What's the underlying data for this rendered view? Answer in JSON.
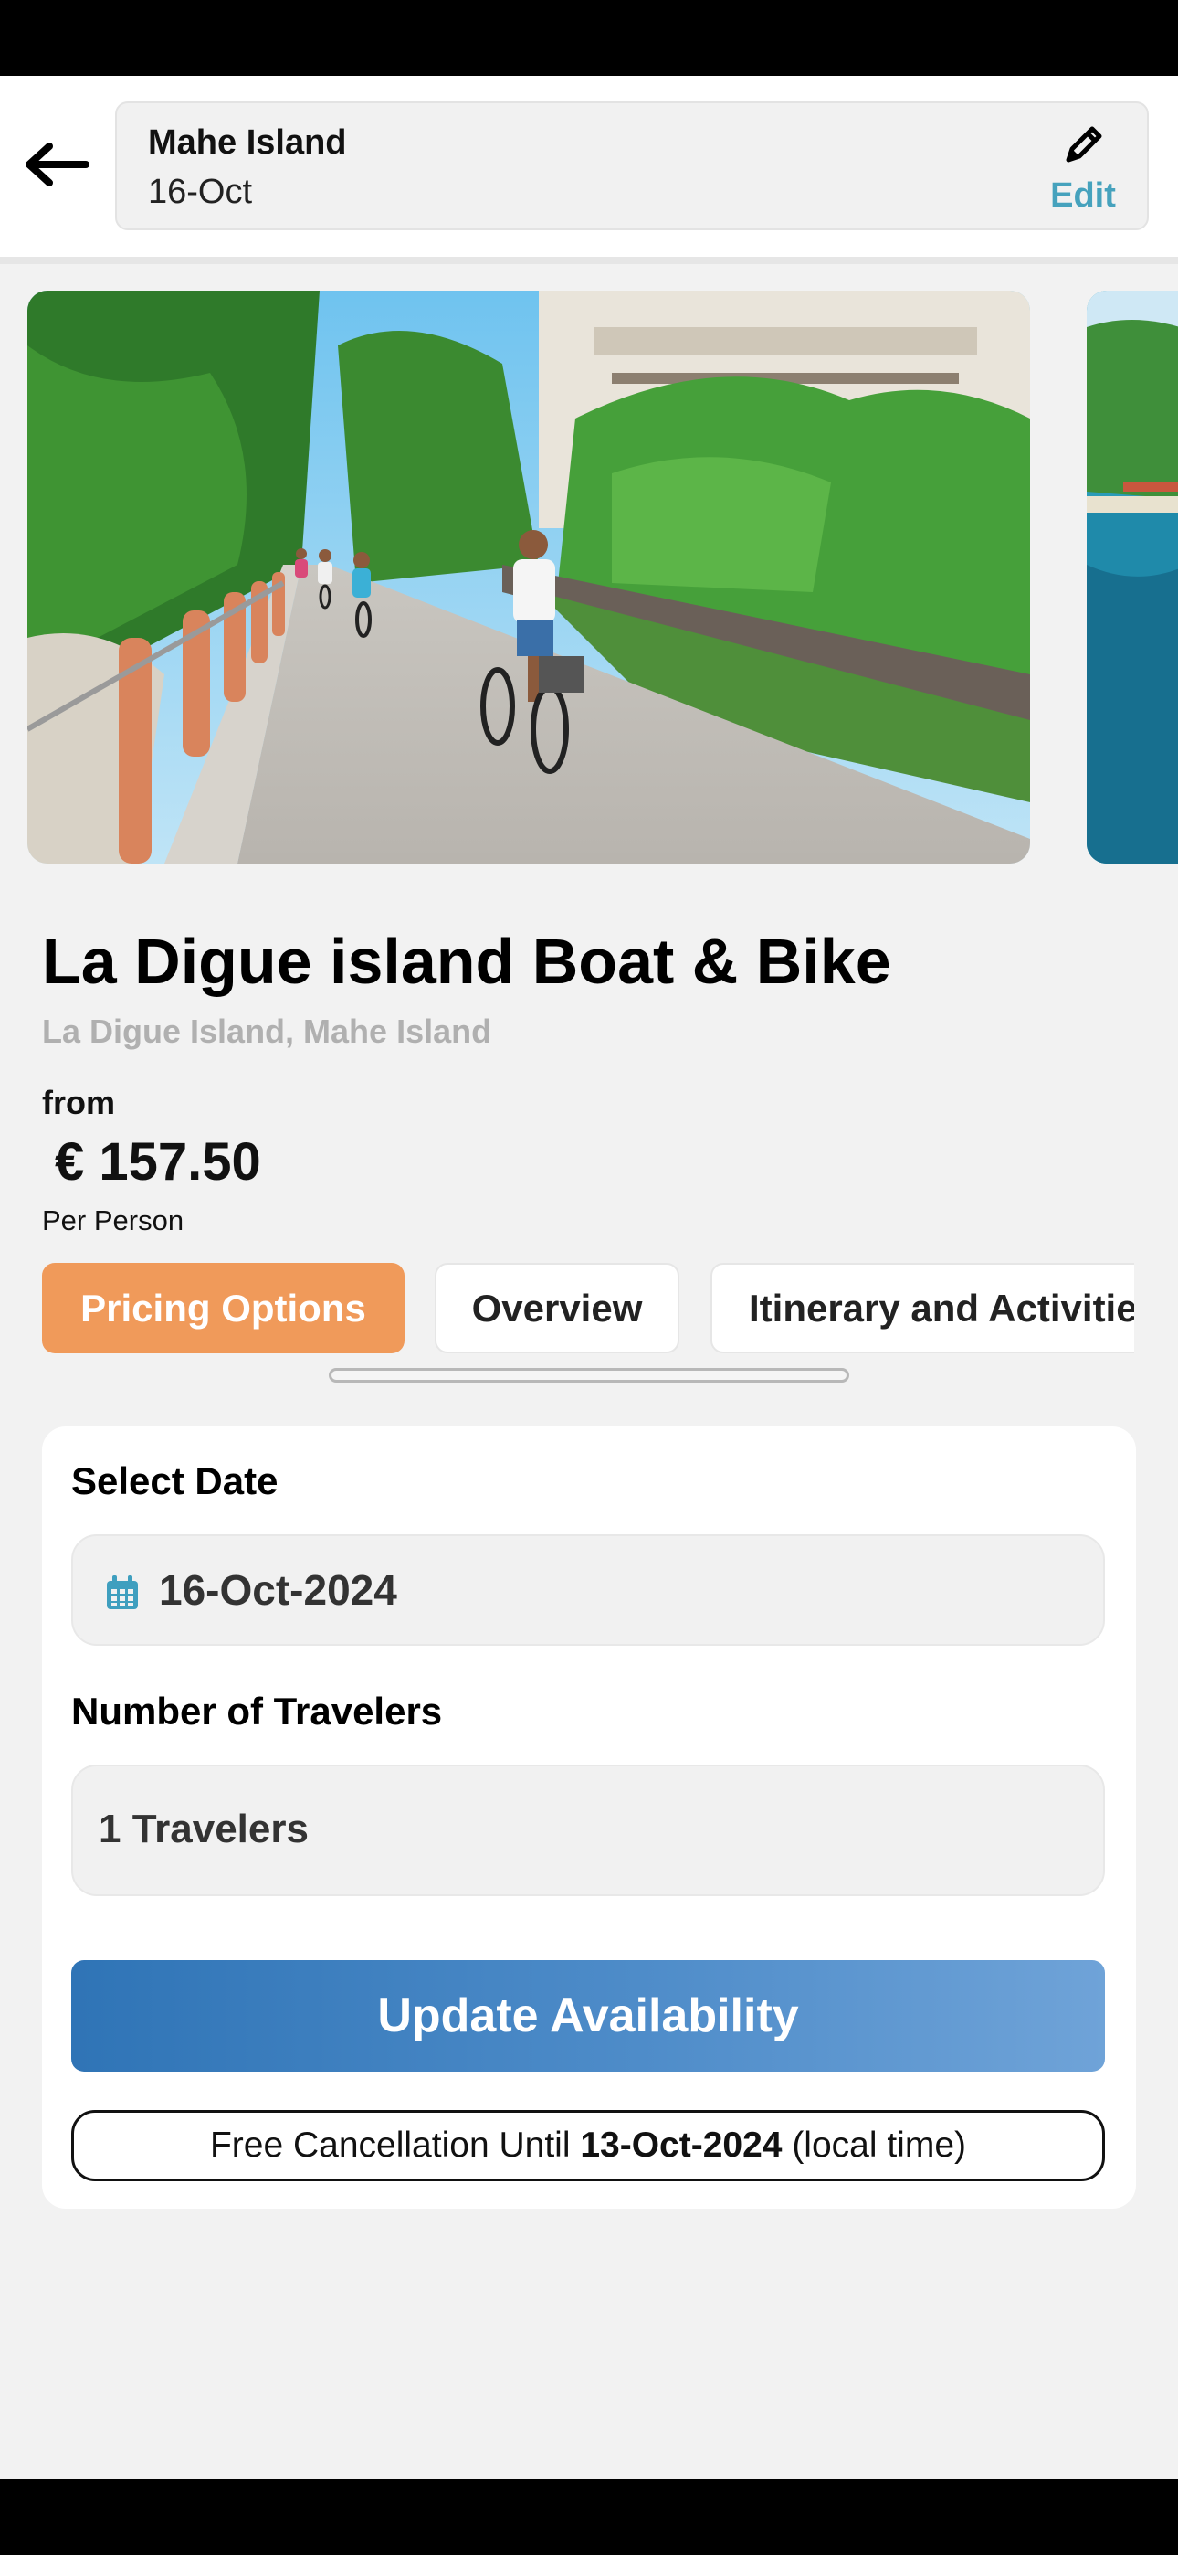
{
  "header": {
    "location": "Mahe Island",
    "date": "16-Oct",
    "edit_label": "Edit"
  },
  "icons": {
    "back": "arrow-left-icon",
    "edit": "pencil-icon",
    "calendar": "calendar-icon"
  },
  "tour": {
    "title": "La Digue island Boat & Bike",
    "subtitle": "La Digue Island, Mahe Island",
    "from_label": "from",
    "price": "€ 157.50",
    "per_person": "Per Person"
  },
  "tabs": [
    {
      "label": "Pricing Options",
      "active": true
    },
    {
      "label": "Overview",
      "active": false
    },
    {
      "label": "Itinerary and Activities",
      "active": false
    }
  ],
  "booking": {
    "select_date_label": "Select Date",
    "date_value": "16-Oct-2024",
    "travelers_label": "Number of Travelers",
    "travelers_value": "1 Travelers",
    "update_button": "Update Availability",
    "cancellation_prefix": "Free Cancellation Until",
    "cancellation_date": "13-Oct-2024",
    "cancellation_suffix": "(local time)"
  },
  "colors": {
    "active_tab": "#f09a5a",
    "edit_accent": "#46a2bd",
    "primary_button_start": "#2f74b6",
    "primary_button_end": "#6fa3d8"
  }
}
